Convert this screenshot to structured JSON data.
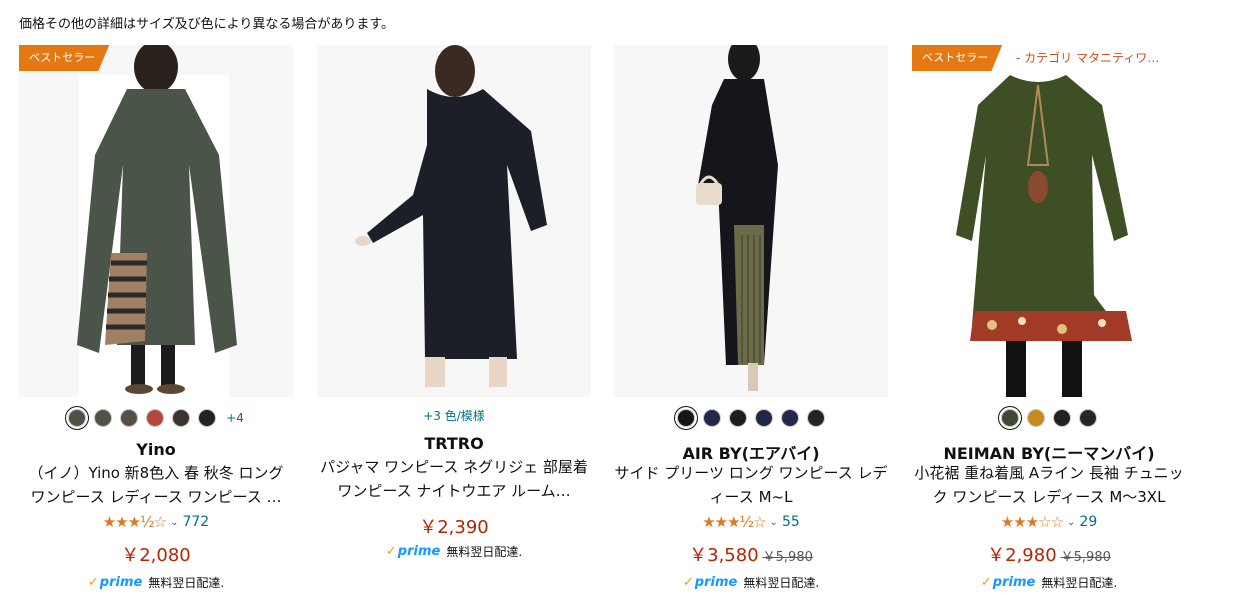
{
  "notice": "価格その他の詳細はサイズ及び色により異なる場合があります。",
  "colors": {
    "accent_orange": "#e47911",
    "price_red": "#b12704",
    "link_teal": "#007185",
    "prime_blue": "#1399ff"
  },
  "products": [
    {
      "badge": "ベストセラー",
      "image_alt": "green-linen-dress-photo",
      "swatches": [
        "#4d5349",
        "#52524a",
        "#585048",
        "#b6463c",
        "#3c3230",
        "#222222"
      ],
      "selected_swatch": 0,
      "more_swatches": "+4",
      "brand": "Yino",
      "title": "（イノ）Yino 新8色入 春 秋冬 ロング ワンピース レディース ワンピース …",
      "stars": "★★★½☆",
      "rating": 3.5,
      "review_count": "772",
      "price": "￥2,080",
      "prime_label": "prime",
      "delivery": "無料翌日配達."
    },
    {
      "image_alt": "black-loungewear-dress-photo",
      "more_colors": "+3 色/模様",
      "brand": "TRTRO",
      "title": "パジャマ ワンピース ネグリジェ 部屋着ワンピース ナイトウエア ルーム…",
      "price": "￥2,390",
      "prime_label": "prime",
      "delivery": "無料翌日配達."
    },
    {
      "image_alt": "black-pleated-dress-photo",
      "swatches": [
        "#151515",
        "#26284a",
        "#1e1e1e",
        "#232545",
        "#25284a",
        "#232520"
      ],
      "selected_swatch": 0,
      "brand": "AIR BY(エアバイ)",
      "title": "サイド プリーツ ロング ワンピース レディース M~L",
      "stars": "★★★½☆",
      "rating": 3.5,
      "review_count": "55",
      "price": "￥3,580",
      "list_price": "￥5,980",
      "prime_label": "prime",
      "delivery": "無料翌日配達."
    },
    {
      "badge": "ベストセラー",
      "badge_ext": "- カテゴリ マタニティワ…",
      "image_alt": "green-floral-tunic-photo",
      "swatches": [
        "#3f4a35",
        "#c98a1c",
        "#222222",
        "#262626"
      ],
      "selected_swatch": 0,
      "brand": "NEIMAN BY(ニーマンバイ)",
      "title": "小花裾 重ね着風 Aライン 長袖 チュニック ワンピース レディース M〜3XL",
      "stars": "★★★☆☆",
      "rating": 3.0,
      "review_count": "29",
      "price": "￥2,980",
      "list_price": "￥5,980",
      "prime_label": "prime",
      "delivery": "無料翌日配達."
    }
  ]
}
